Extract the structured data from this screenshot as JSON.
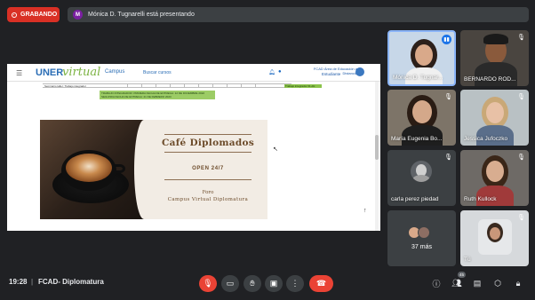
{
  "recording": {
    "label": "GRABANDO"
  },
  "presenting": {
    "avatar_letter": "M",
    "text": "Mónica D. Tugnarelli está presentando"
  },
  "shared_site": {
    "logo_uner": "UNER",
    "logo_virtual": "virtual",
    "nav_campus": "Campus",
    "nav_search": "Buscar cursos",
    "org_line1": "FCAD Área de Educación a Distancia",
    "role": "Estudiante",
    "table_row_label": "Seminario taller: Trabajo integrador",
    "green_cell": "Trabajo integrador   01-dic",
    "green_band_line1": "TRABAJO INTEGRADOR: PRIMERA FECHA DE ENTREGA: 12 DE DICIEMBRE 2022",
    "green_band_line2": "SEGUNDA FECHA DE ENTREGA: 21 DE FEBRERO 2023",
    "banner_title": "Café Diplomados",
    "banner_open": "OPEN 24/7",
    "banner_foro": "Foro",
    "banner_campus": "Campus Virtual Diplomatura"
  },
  "participants": [
    {
      "name": "Mónica D. Tugnar...",
      "speaking": true
    },
    {
      "name": "BERNARDO ROD...",
      "muted": true
    },
    {
      "name": "María Eugenia Bo...",
      "muted": true
    },
    {
      "name": "Jessica Jufoczko",
      "muted": true
    },
    {
      "name": "carla perez piedad",
      "muted": true
    },
    {
      "name": "Ruth Kullock",
      "muted": true
    },
    {
      "name": "37 más"
    },
    {
      "name": "Tú",
      "muted": true
    }
  ],
  "bottom_bar": {
    "time": "19:28",
    "separator": "|",
    "meeting_name": "FCAD- Diplomatura",
    "participant_count": "45"
  },
  "colors": {
    "record": "#d93025",
    "end_call": "#ea4335",
    "speaking": "#8ab4f8",
    "bar_bg": "#202124"
  }
}
